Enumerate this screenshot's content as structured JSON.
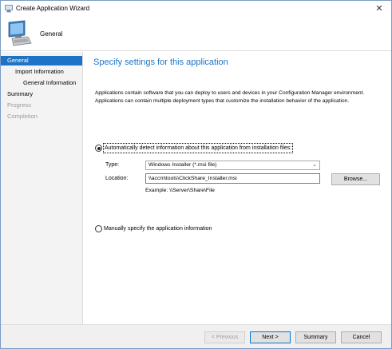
{
  "window": {
    "title": "Create Application Wizard",
    "close_glyph": "✕"
  },
  "banner": {
    "title": "General",
    "icon": "computer-icon"
  },
  "nav": {
    "items": [
      {
        "label": "General",
        "state": "selected"
      },
      {
        "label": "Import Information",
        "state": "normal"
      },
      {
        "label": "General Information",
        "state": "normal"
      },
      {
        "label": "Summary",
        "state": "normal"
      },
      {
        "label": "Progress",
        "state": "disabled"
      },
      {
        "label": "Completion",
        "state": "disabled"
      }
    ]
  },
  "main": {
    "title": "Specify settings for this application",
    "description": "Applications contain software that you can deploy to users and devices in your Configuration Manager environment. Applications can contain multiple deployment types that customize the installation behavior of the application.",
    "auto_option": {
      "label": "Automatically detect information about this application from installation files:",
      "checked": true
    },
    "type": {
      "label": "Type:",
      "value": "Windows Installer (*.msi file)"
    },
    "location": {
      "label": "Location:",
      "value": "\\\\accm\\tools\\ClickShare_Installer.msi",
      "example": "Example: \\\\Server\\Share\\File"
    },
    "browse_label": "Browse...",
    "manual_option": {
      "label": "Manually specify the application information",
      "checked": false
    }
  },
  "footer": {
    "previous_label": "< Previous",
    "next_label": "Next >",
    "summary_label": "Summary",
    "cancel_label": "Cancel"
  },
  "colors": {
    "accent": "#1e73c6",
    "nav_bg": "#f3f3f3",
    "footer_bg": "#f0f0f0"
  }
}
